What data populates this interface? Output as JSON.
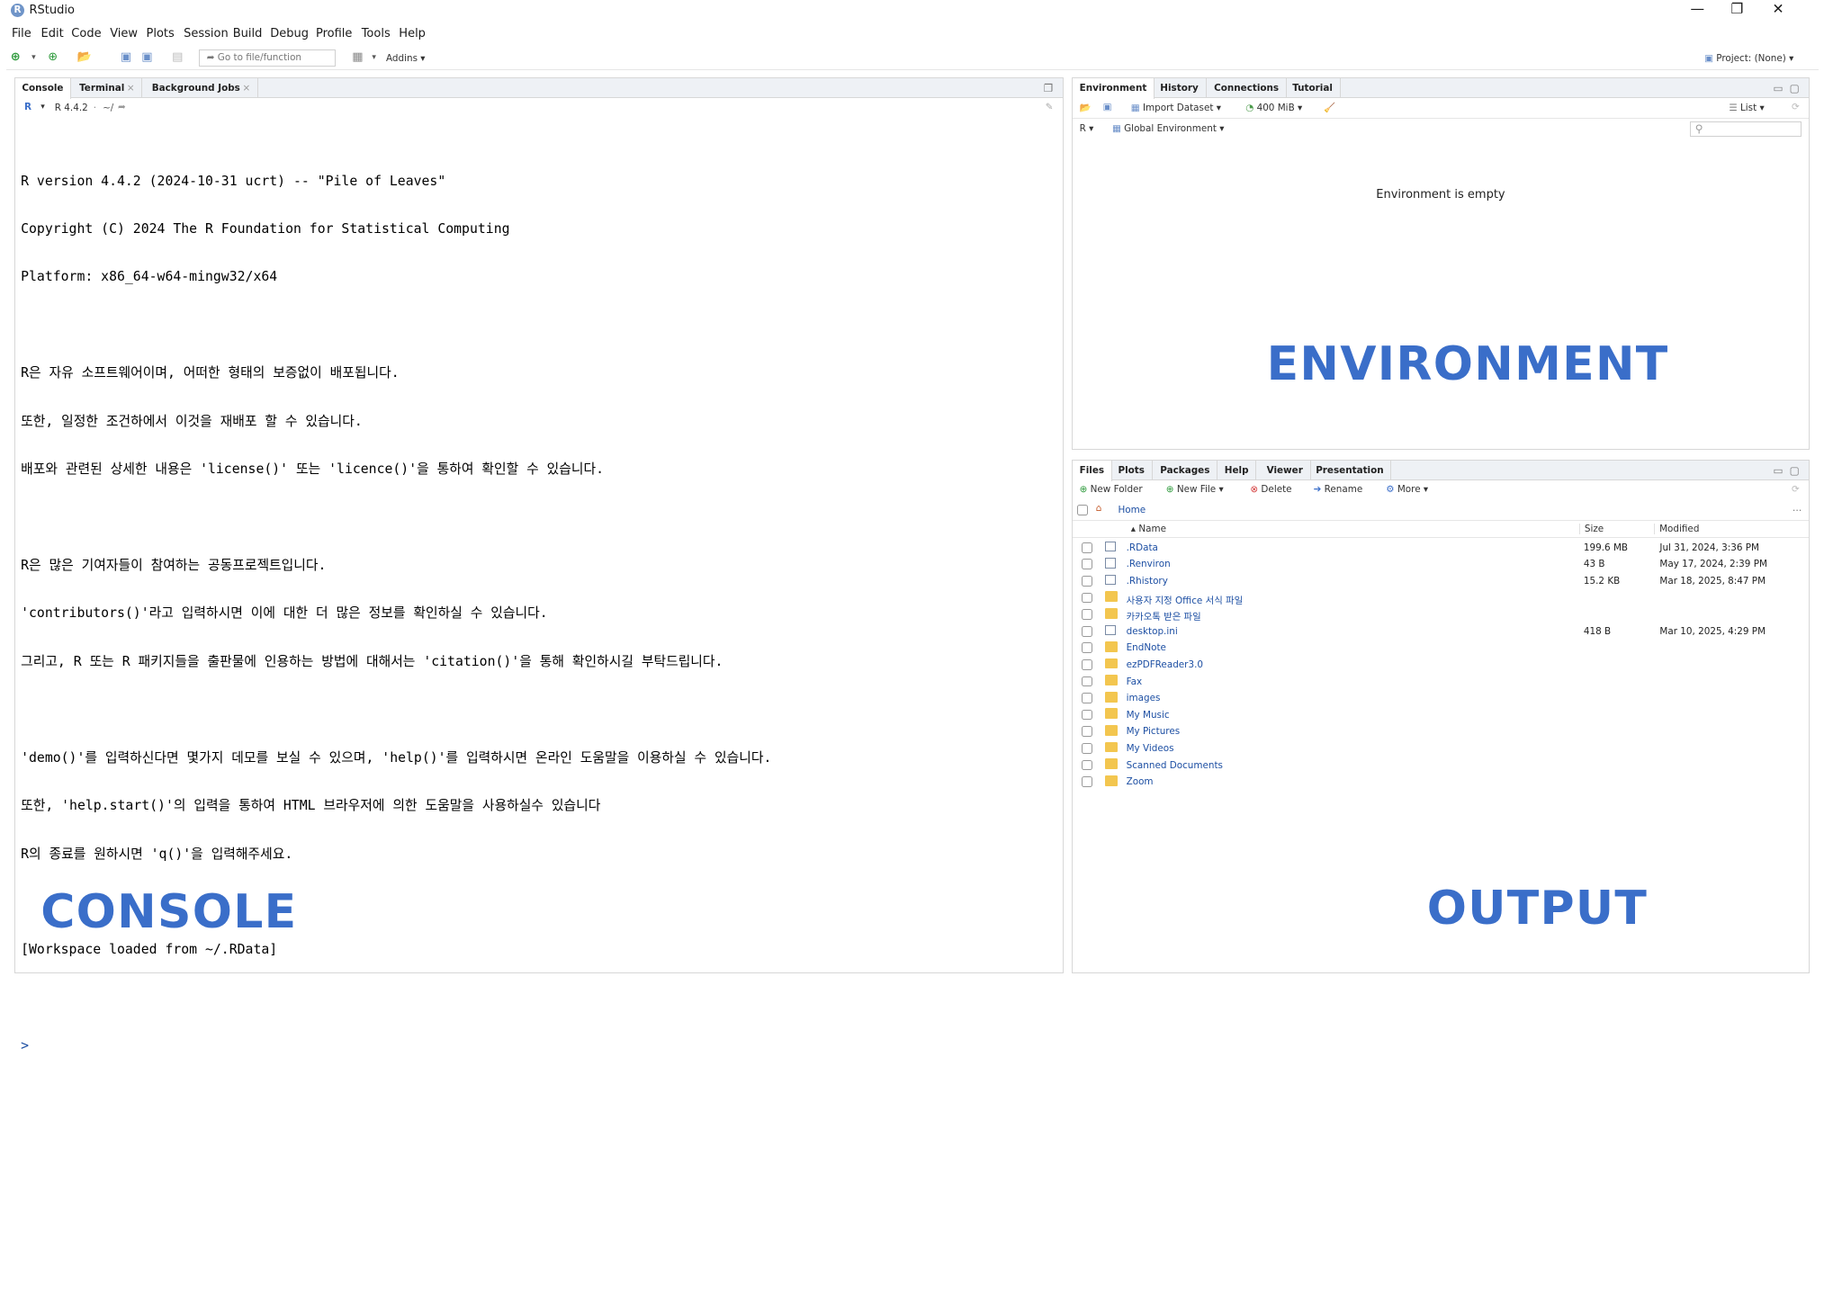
{
  "window": {
    "title": "RStudio",
    "logo": "R",
    "controls": [
      "—",
      "❐",
      "✕"
    ]
  },
  "menu": [
    "File",
    "Edit",
    "Code",
    "View",
    "Plots",
    "Session",
    "Build",
    "Debug",
    "Profile",
    "Tools",
    "Help"
  ],
  "toolbar": {
    "goto_placeholder": "Go to file/function",
    "addins": "Addins",
    "project": "Project: (None)"
  },
  "console_panel": {
    "tabs": [
      {
        "label": "Console"
      },
      {
        "label": "Terminal"
      },
      {
        "label": "Background Jobs"
      }
    ],
    "r_version": "R 4.4.2",
    "path": "~/",
    "lines": [
      "R version 4.4.2 (2024-10-31 ucrt) -- \"Pile of Leaves\"",
      "Copyright (C) 2024 The R Foundation for Statistical Computing",
      "Platform: x86_64-w64-mingw32/x64",
      "",
      "R은 자유 소프트웨어이며, 어떠한 형태의 보증없이 배포됩니다.",
      "또한, 일정한 조건하에서 이것을 재배포 할 수 있습니다.",
      "배포와 관련된 상세한 내용은 'license()' 또는 'licence()'을 통하여 확인할 수 있습니다.",
      "",
      "R은 많은 기여자들이 참여하는 공동프로젝트입니다.",
      "'contributors()'라고 입력하시면 이에 대한 더 많은 정보를 확인하실 수 있습니다.",
      "그리고, R 또는 R 패키지들을 출판물에 인용하는 방법에 대해서는 'citation()'을 통해 확인하시길 부탁드립니다.",
      "",
      "'demo()'를 입력하신다면 몇가지 데모를 보실 수 있으며, 'help()'를 입력하시면 온라인 도움말을 이용하실 수 있습니다.",
      "또한, 'help.start()'의 입력을 통하여 HTML 브라우저에 의한 도움말을 사용하실수 있습니다",
      "R의 종료를 원하시면 'q()'을 입력해주세요.",
      "",
      "[Workspace loaded from ~/.RData]",
      "",
      "> "
    ],
    "annotation": "CONSOLE"
  },
  "env_panel": {
    "tabs": [
      {
        "label": "Environment"
      },
      {
        "label": "History"
      },
      {
        "label": "Connections"
      },
      {
        "label": "Tutorial"
      }
    ],
    "import_dataset": "Import Dataset",
    "memory": "400 MiB",
    "view_mode": "List",
    "language": "R",
    "scope": "Global Environment",
    "empty_message": "Environment is empty",
    "annotation": "ENVIRONMENT"
  },
  "files_panel": {
    "tabs": [
      {
        "label": "Files"
      },
      {
        "label": "Plots"
      },
      {
        "label": "Packages"
      },
      {
        "label": "Help"
      },
      {
        "label": "Viewer"
      },
      {
        "label": "Presentation"
      }
    ],
    "actions": {
      "new_folder": "New Folder",
      "new_file": "New File",
      "delete": "Delete",
      "rename": "Rename",
      "more": "More"
    },
    "home": "Home",
    "columns": {
      "name": "Name",
      "size": "Size",
      "modified": "Modified"
    },
    "files": [
      {
        "name": ".RData",
        "size": "199.6 MB",
        "modified": "Jul 31, 2024, 3:36 PM",
        "kind": "file"
      },
      {
        "name": ".Renviron",
        "size": "43 B",
        "modified": "May 17, 2024, 2:39 PM",
        "kind": "file"
      },
      {
        "name": ".Rhistory",
        "size": "15.2 KB",
        "modified": "Mar 18, 2025, 8:47 PM",
        "kind": "file"
      },
      {
        "name": "사용자 지정 Office 서식 파일",
        "size": "",
        "modified": "",
        "kind": "folder"
      },
      {
        "name": "카카오톡 받은 파일",
        "size": "",
        "modified": "",
        "kind": "folder"
      },
      {
        "name": "desktop.ini",
        "size": "418 B",
        "modified": "Mar 10, 2025, 4:29 PM",
        "kind": "file"
      },
      {
        "name": "EndNote",
        "size": "",
        "modified": "",
        "kind": "folder"
      },
      {
        "name": "ezPDFReader3.0",
        "size": "",
        "modified": "",
        "kind": "folder"
      },
      {
        "name": "Fax",
        "size": "",
        "modified": "",
        "kind": "folder"
      },
      {
        "name": "images",
        "size": "",
        "modified": "",
        "kind": "folder"
      },
      {
        "name": "My Music",
        "size": "",
        "modified": "",
        "kind": "folder"
      },
      {
        "name": "My Pictures",
        "size": "",
        "modified": "",
        "kind": "folder"
      },
      {
        "name": "My Videos",
        "size": "",
        "modified": "",
        "kind": "folder"
      },
      {
        "name": "Scanned Documents",
        "size": "",
        "modified": "",
        "kind": "folder"
      },
      {
        "name": "Zoom",
        "size": "",
        "modified": "",
        "kind": "folder"
      }
    ],
    "annotation": "OUTPUT"
  },
  "colors": {
    "annotation": "#3a6ec9",
    "link": "#1d4fa3",
    "tabbar": "#eef1f5"
  }
}
